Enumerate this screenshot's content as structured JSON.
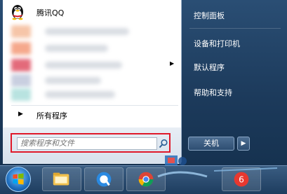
{
  "start_menu": {
    "pinned": [
      {
        "label": "腾讯QQ",
        "icon": "qq-penguin-icon"
      }
    ],
    "all_programs_label": "所有程序",
    "search": {
      "placeholder": "搜索程序和文件"
    },
    "right_items": [
      "控制面板",
      "设备和打印机",
      "默认程序",
      "帮助和支持"
    ],
    "shutdown_label": "关机"
  },
  "taskbar": {
    "items": [
      "windows-start-orb",
      "file-explorer-icon",
      "browser-icon",
      "chrome-icon",
      "app-icon"
    ]
  },
  "colors": {
    "highlight_red": "#e0192a",
    "menu_blue": "#1c3a5b"
  }
}
